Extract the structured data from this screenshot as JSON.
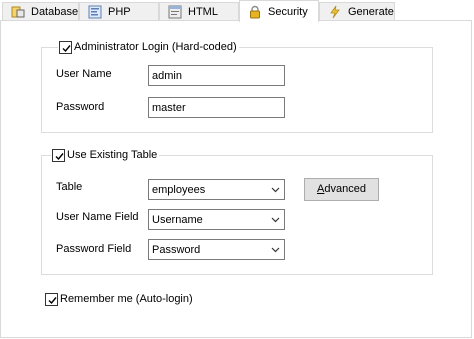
{
  "tabs": [
    {
      "label": "Database",
      "icon": "database-icon"
    },
    {
      "label": "PHP",
      "icon": "php-icon"
    },
    {
      "label": "HTML",
      "icon": "html-icon"
    },
    {
      "label": "Security",
      "icon": "lock-icon"
    },
    {
      "label": "Generate",
      "icon": "lightning-icon"
    }
  ],
  "active_tab": "Security",
  "admin_login": {
    "title": "Administrator Login (Hard-coded)",
    "checked": true,
    "user_name_label": "User Name",
    "user_name_value": "admin",
    "password_label": "Password",
    "password_value": "master"
  },
  "existing_table": {
    "title": "Use Existing Table",
    "checked": true,
    "table_label": "Table",
    "table_value": "employees",
    "advanced_button": {
      "prefix": "",
      "mnemonic": "A",
      "rest": "dvanced"
    },
    "user_name_field_label": "User Name Field",
    "user_name_field_value": "Username",
    "password_field_label": "Password Field",
    "password_field_value": "Password"
  },
  "remember_me": {
    "label": "Remember me (Auto-login)",
    "checked": true
  },
  "colors": {
    "tab_inactive_bg": "#f0f0f0",
    "border": "#d9d9d9",
    "button_bg": "#e1e1e1",
    "input_border": "#7a7a7a"
  }
}
